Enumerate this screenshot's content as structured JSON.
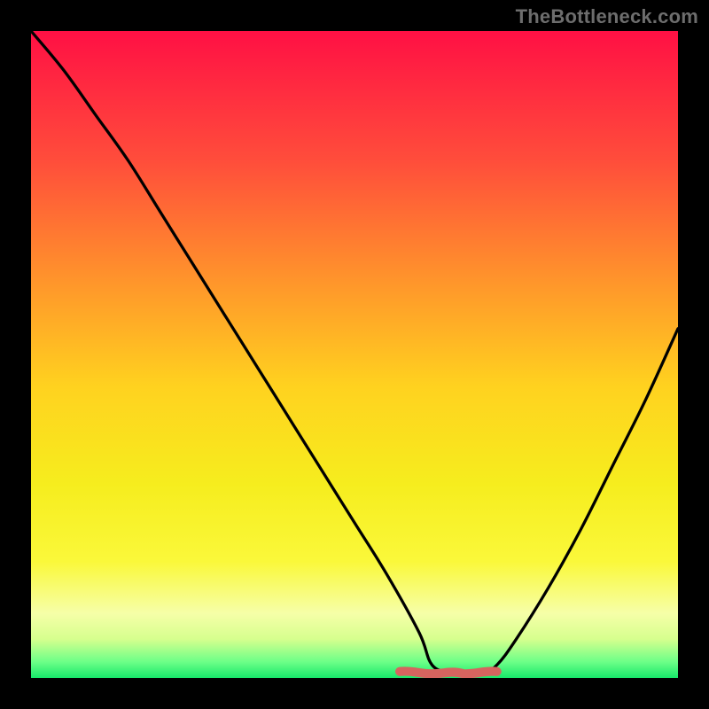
{
  "watermark": "TheBottleneck.com",
  "colors": {
    "frame": "#000000",
    "curve": "#000000",
    "accent": "#d6645f",
    "gradient_stops": [
      {
        "offset": 0.0,
        "color": "#ff1044"
      },
      {
        "offset": 0.2,
        "color": "#ff4d3b"
      },
      {
        "offset": 0.4,
        "color": "#ff9a2a"
      },
      {
        "offset": 0.55,
        "color": "#ffd21f"
      },
      {
        "offset": 0.7,
        "color": "#f6ed1e"
      },
      {
        "offset": 0.82,
        "color": "#faf83a"
      },
      {
        "offset": 0.9,
        "color": "#f6ffa8"
      },
      {
        "offset": 0.94,
        "color": "#d6ff8e"
      },
      {
        "offset": 0.975,
        "color": "#6dff88"
      },
      {
        "offset": 1.0,
        "color": "#17e86a"
      }
    ]
  },
  "chart_data": {
    "type": "line",
    "title": "",
    "xlabel": "",
    "ylabel": "",
    "xlim": [
      0,
      100
    ],
    "ylim": [
      0,
      100
    ],
    "legend": false,
    "grid": false,
    "series": [
      {
        "name": "bottleneck-curve",
        "x": [
          0,
          5,
          10,
          15,
          20,
          25,
          30,
          35,
          40,
          45,
          50,
          55,
          60,
          62,
          65,
          70,
          72,
          75,
          80,
          85,
          90,
          95,
          100
        ],
        "y": [
          100,
          94,
          87,
          80,
          72,
          64,
          56,
          48,
          40,
          32,
          24,
          16,
          7,
          2,
          1,
          1,
          2,
          6,
          14,
          23,
          33,
          43,
          54
        ]
      },
      {
        "name": "bottom-accent",
        "x": [
          57,
          72
        ],
        "y": [
          1.0,
          1.0
        ]
      }
    ],
    "annotations": [
      {
        "text": "TheBottleneck.com",
        "position": "top-right"
      }
    ]
  }
}
